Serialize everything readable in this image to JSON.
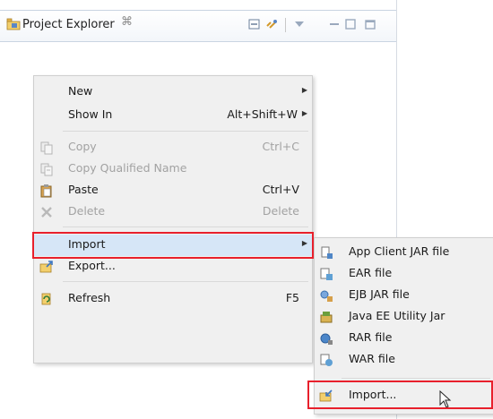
{
  "view": {
    "title": "Project Explorer",
    "close_glyph": "⌘"
  },
  "menu": {
    "items": [
      {
        "label": "New",
        "accelerator": "",
        "submenu": true,
        "disabled": false,
        "icon": "none"
      },
      {
        "label": "Show In",
        "accelerator": "Alt+Shift+W",
        "submenu": true,
        "disabled": false,
        "icon": "none"
      },
      {
        "label": "Copy",
        "accelerator": "Ctrl+C",
        "submenu": false,
        "disabled": true,
        "icon": "copy-icon"
      },
      {
        "label": "Copy Qualified Name",
        "accelerator": "",
        "submenu": false,
        "disabled": true,
        "icon": "copy-qualified-name-icon"
      },
      {
        "label": "Paste",
        "accelerator": "Ctrl+V",
        "submenu": false,
        "disabled": false,
        "icon": "paste-icon"
      },
      {
        "label": "Delete",
        "accelerator": "Delete",
        "submenu": false,
        "disabled": true,
        "icon": "delete-icon"
      },
      {
        "label": "Import",
        "accelerator": "",
        "submenu": true,
        "disabled": false,
        "icon": "none"
      },
      {
        "label": "Export...",
        "accelerator": "",
        "submenu": false,
        "disabled": false,
        "icon": "export-icon"
      },
      {
        "label": "Refresh",
        "accelerator": "F5",
        "submenu": false,
        "disabled": false,
        "icon": "refresh-icon"
      }
    ]
  },
  "submenu": {
    "items": [
      {
        "label": "App Client JAR file",
        "icon": "app-client-jar-icon"
      },
      {
        "label": "EAR file",
        "icon": "ear-file-icon"
      },
      {
        "label": "EJB JAR file",
        "icon": "ejb-jar-icon"
      },
      {
        "label": "Java EE Utility Jar",
        "icon": "java-ee-utility-jar-icon"
      },
      {
        "label": "RAR file",
        "icon": "rar-file-icon"
      },
      {
        "label": "WAR file",
        "icon": "war-file-icon"
      },
      {
        "label": "Import...",
        "icon": "import-icon"
      }
    ]
  },
  "colors": {
    "highlight_box": "#e8202c",
    "menu_bg": "#f0f0f0",
    "disabled_text": "#a2a2a2"
  }
}
